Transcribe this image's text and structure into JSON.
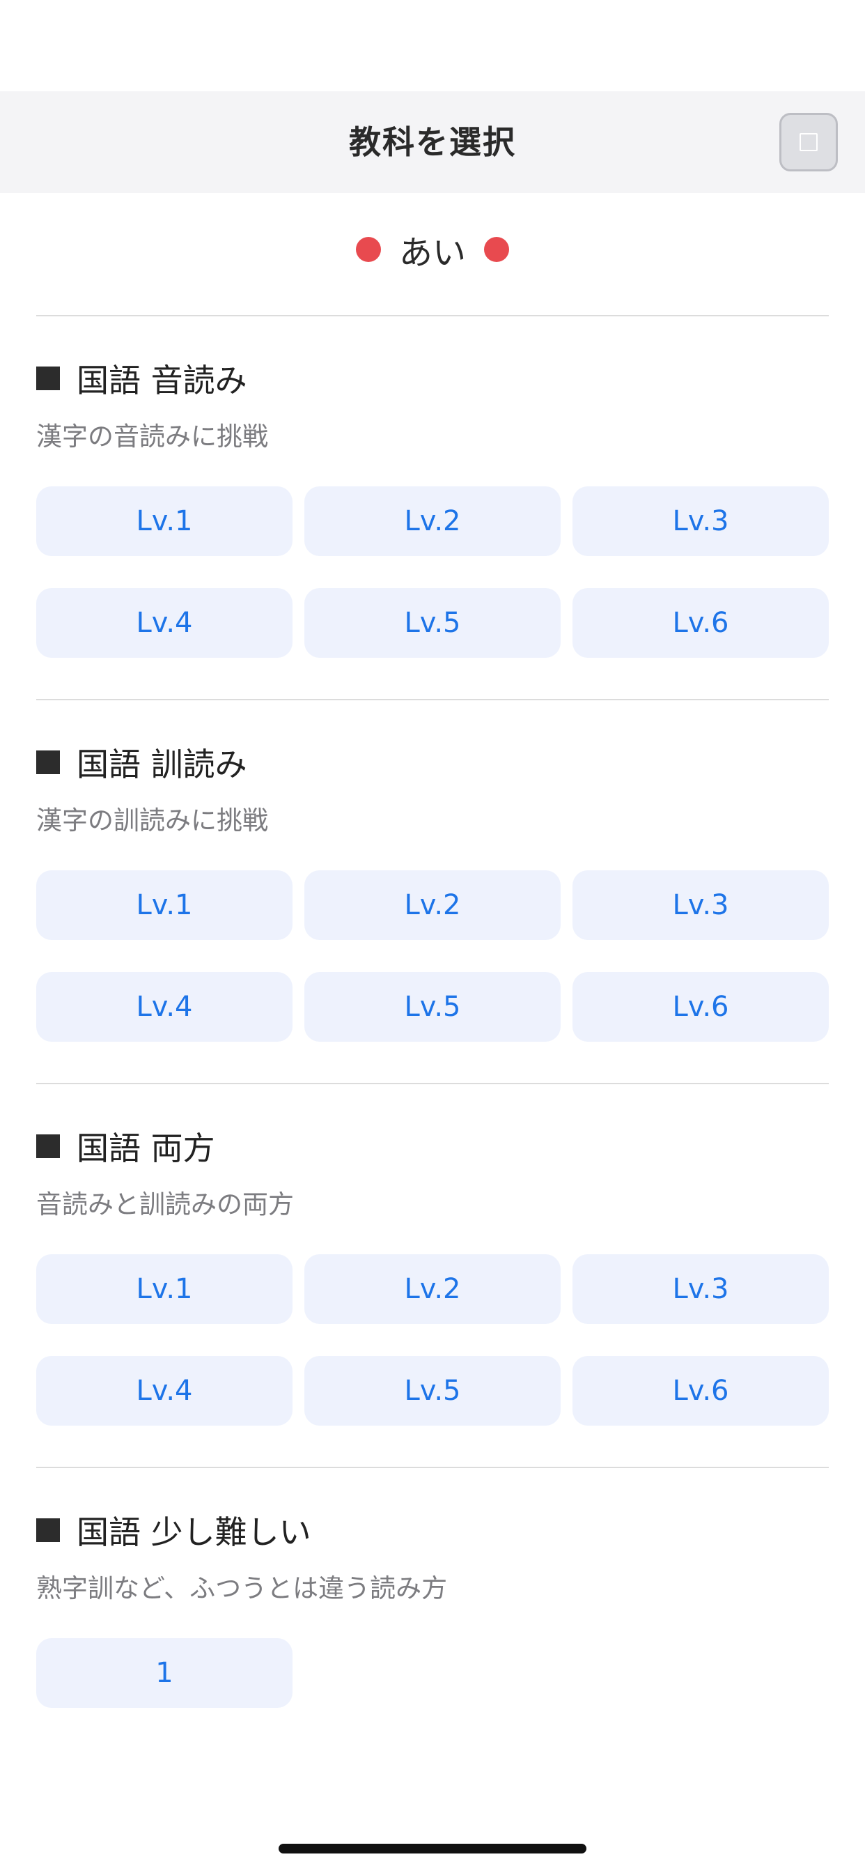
{
  "nav": {
    "title": "教科を選択",
    "close_icon": "square-icon"
  },
  "user": {
    "name": "あい",
    "dot_color": "#e84a4f"
  },
  "sections": [
    {
      "title": "国語 音読み",
      "subtitle": "漢字の音読みに挑戦",
      "levels": [
        "Lv.1",
        "Lv.2",
        "Lv.3",
        "Lv.4",
        "Lv.5",
        "Lv.6"
      ]
    },
    {
      "title": "国語 訓読み",
      "subtitle": "漢字の訓読みに挑戦",
      "levels": [
        "Lv.1",
        "Lv.2",
        "Lv.3",
        "Lv.4",
        "Lv.5",
        "Lv.6"
      ]
    },
    {
      "title": "国語 両方",
      "subtitle": "音読みと訓読みの両方",
      "levels": [
        "Lv.1",
        "Lv.2",
        "Lv.3",
        "Lv.4",
        "Lv.5",
        "Lv.6"
      ]
    },
    {
      "title": "国語 少し難しい",
      "subtitle": "熟字訓など、ふつうとは違う読み方",
      "levels": [
        "1"
      ]
    }
  ],
  "colors": {
    "accent": "#1d74e8",
    "button_bg": "#eef2fd",
    "nav_bg": "#f4f4f6"
  }
}
